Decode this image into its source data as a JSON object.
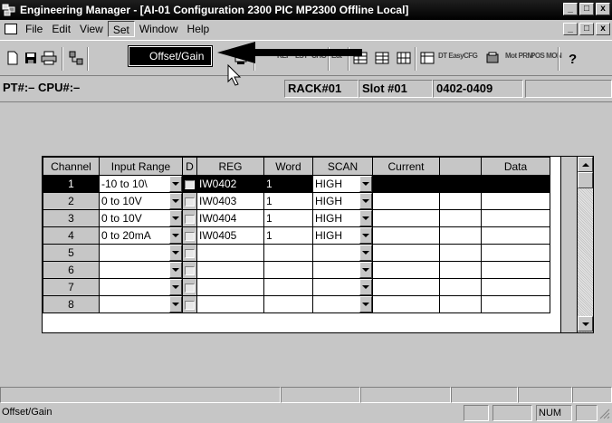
{
  "window": {
    "title": "Engineering Manager - [AI-01 Configuration   2300 PIC MP2300   Offline Local]",
    "minimize": "_",
    "maximize": "□",
    "close": "x"
  },
  "menubar": {
    "items": [
      "File",
      "Edit",
      "View",
      "Set",
      "Window",
      "Help"
    ],
    "active": "Set",
    "dropdown_item": "Offset/Gain"
  },
  "toolbar": {
    "text_buttons": [
      "REF",
      "LST",
      "CHG",
      "Edt",
      "DT Easy",
      "CFG",
      "Mot PRM",
      "POS MON"
    ]
  },
  "infobar": {
    "pt_cpu": "PT#:– CPU#:–",
    "rack": "RACK#01",
    "slot": "Slot #01",
    "range": "0402-0409"
  },
  "grid": {
    "headers": [
      "Channel",
      "Input Range",
      "D",
      "REG",
      "Word",
      "SCAN",
      "Current",
      "",
      "Data"
    ],
    "rows": [
      {
        "channel": "1",
        "input_range": "-10 to 10\\",
        "reg": "IW0402",
        "word": "1",
        "scan": "HIGH",
        "selected": true
      },
      {
        "channel": "2",
        "input_range": "0 to 10V",
        "reg": "IW0403",
        "word": "1",
        "scan": "HIGH",
        "selected": false
      },
      {
        "channel": "3",
        "input_range": "0 to 10V",
        "reg": "IW0404",
        "word": "1",
        "scan": "HIGH",
        "selected": false
      },
      {
        "channel": "4",
        "input_range": "0 to 20mA",
        "reg": "IW0405",
        "word": "1",
        "scan": "HIGH",
        "selected": false
      },
      {
        "channel": "5",
        "input_range": "",
        "reg": "",
        "word": "",
        "scan": "",
        "selected": false
      },
      {
        "channel": "6",
        "input_range": "",
        "reg": "",
        "word": "",
        "scan": "",
        "selected": false
      },
      {
        "channel": "7",
        "input_range": "",
        "reg": "",
        "word": "",
        "scan": "",
        "selected": false
      },
      {
        "channel": "8",
        "input_range": "",
        "reg": "",
        "word": "",
        "scan": "",
        "selected": false
      }
    ]
  },
  "statusbar": {
    "message": "Offset/Gain",
    "num": "NUM"
  }
}
